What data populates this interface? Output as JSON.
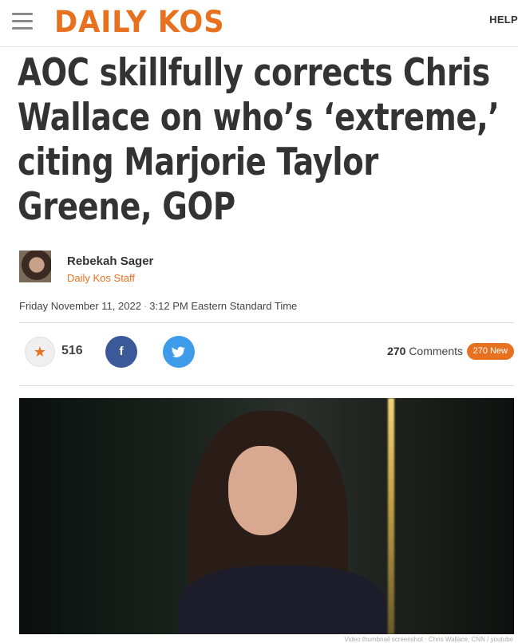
{
  "header": {
    "logo_text": "DAILY KOS",
    "help_label": "HELP"
  },
  "article": {
    "title": "AOC skillfully corrects Chris Wallace on who’s ‘extreme,’ citing Marjorie Taylor Greene, GOP",
    "author": {
      "name": "Rebekah Sager",
      "role": "Daily Kos Staff"
    },
    "date": "Friday November 11, 2022",
    "date_separator": "·",
    "time": "3:12 PM Eastern Standard Time"
  },
  "social": {
    "recommend_count": "516",
    "facebook_glyph": "f",
    "twitter_glyph": "t",
    "comments_count": "270",
    "comments_label": "Comments",
    "new_badge": "270 New"
  },
  "photo": {
    "caption": "Video thumbnail screenshot · Chris Wallace, CNN / youtube"
  },
  "colors": {
    "brand_orange": "#e8711f",
    "facebook_blue": "#3b5998",
    "twitter_blue": "#3d9be9"
  },
  "icons": {
    "menu": "hamburger-icon",
    "recommend": "star-icon",
    "facebook": "facebook-icon",
    "twitter": "twitter-icon"
  }
}
